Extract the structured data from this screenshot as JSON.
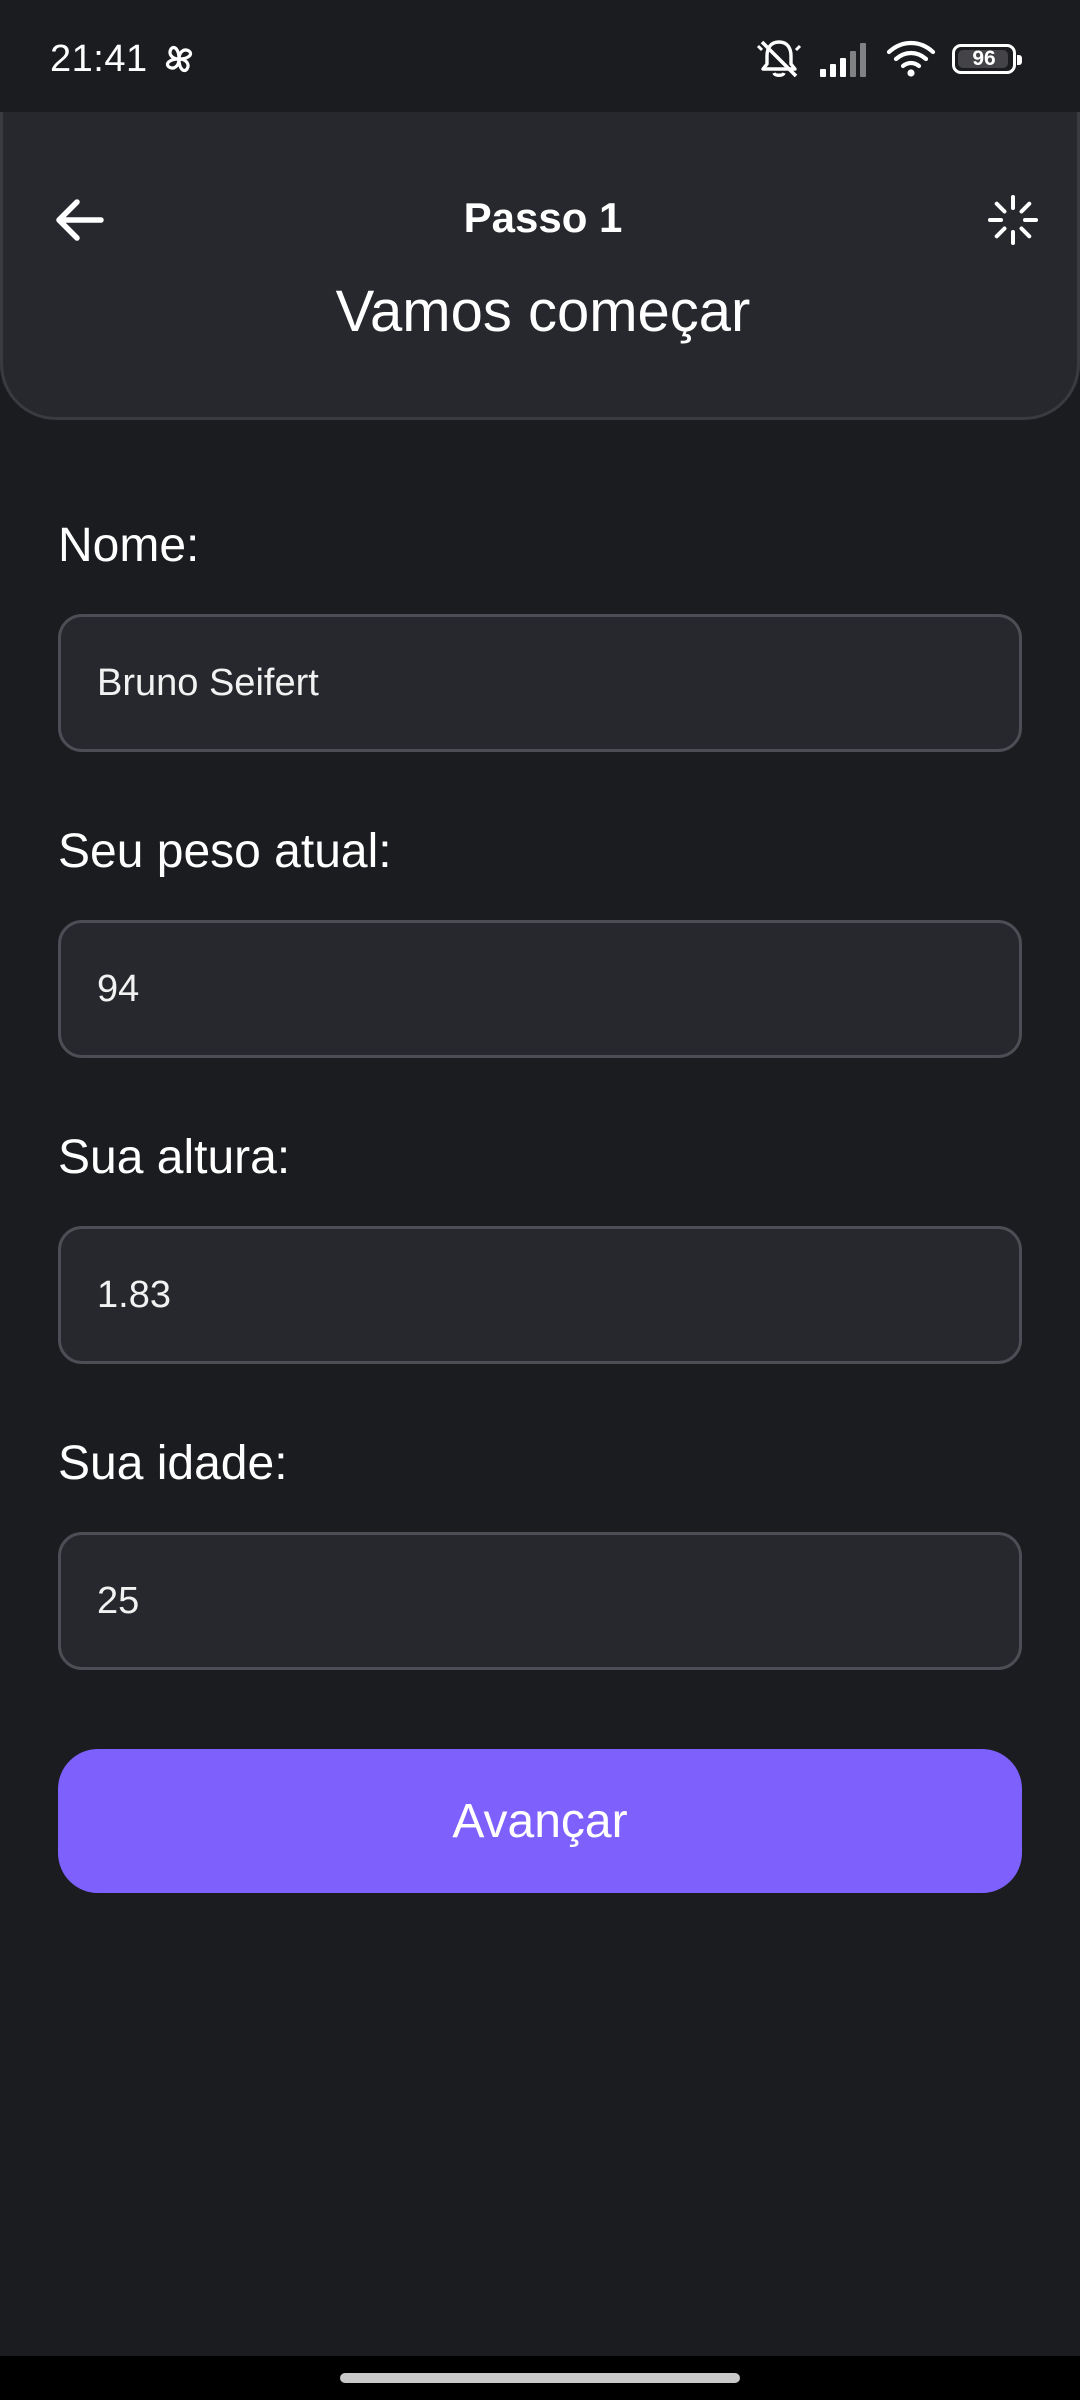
{
  "status_bar": {
    "time": "21:41",
    "app_icon": "pinwheel-icon",
    "icons": [
      "mute-icon",
      "signal-icon",
      "wifi-icon"
    ],
    "battery_level": 96,
    "battery_text": "96"
  },
  "header": {
    "back_icon": "arrow-left-icon",
    "step_title": "Passo 1",
    "subtitle": "Vamos começar",
    "action_icon": "loading-spinner-icon"
  },
  "form": {
    "fields": [
      {
        "label": "Nome:",
        "value": "Bruno Seifert"
      },
      {
        "label": "Seu peso atual:",
        "value": "94"
      },
      {
        "label": "Sua altura:",
        "value": "1.83"
      },
      {
        "label": "Sua idade:",
        "value": "25"
      }
    ],
    "submit_label": "Avançar"
  },
  "colors": {
    "background": "#1b1c20",
    "card": "#27282d",
    "accent": "#7e61fd",
    "input_border": "#4d4e55"
  }
}
